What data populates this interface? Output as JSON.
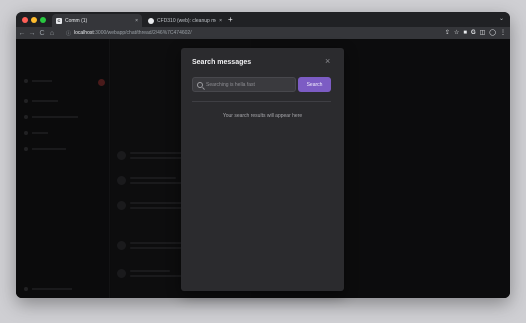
{
  "browser": {
    "tabs": [
      {
        "favicon": "C",
        "title": "Comm (1)",
        "close": "×",
        "active": true
      },
      {
        "favicon": "⬤",
        "title": "CFD310 (web): cleanup mo",
        "close": "×",
        "active": false
      }
    ],
    "new_tab": "+",
    "tab_menu": "⌄",
    "url_host": "localhost",
    "url_path": ":3000/webapp/chat/thread/2/46%7C474602/",
    "nav": {
      "back": "←",
      "forward": "→",
      "reload": "C",
      "home": "⌂"
    },
    "toolbar_icons": {
      "share": "⇪",
      "star": "☆",
      "ext": "■",
      "g": "G",
      "panel": "◫",
      "profile": "◯",
      "menu": "⋮"
    }
  },
  "modal": {
    "title": "Search messages",
    "close": "×",
    "search_placeholder": "Searching is hella fast",
    "search_button": "Search",
    "empty_text": "Your search results will appear here"
  },
  "colors": {
    "accent": "#7c5cc4",
    "modal_bg": "#2b2b2e",
    "overlay": "rgba(0,0,0,0.55)"
  }
}
